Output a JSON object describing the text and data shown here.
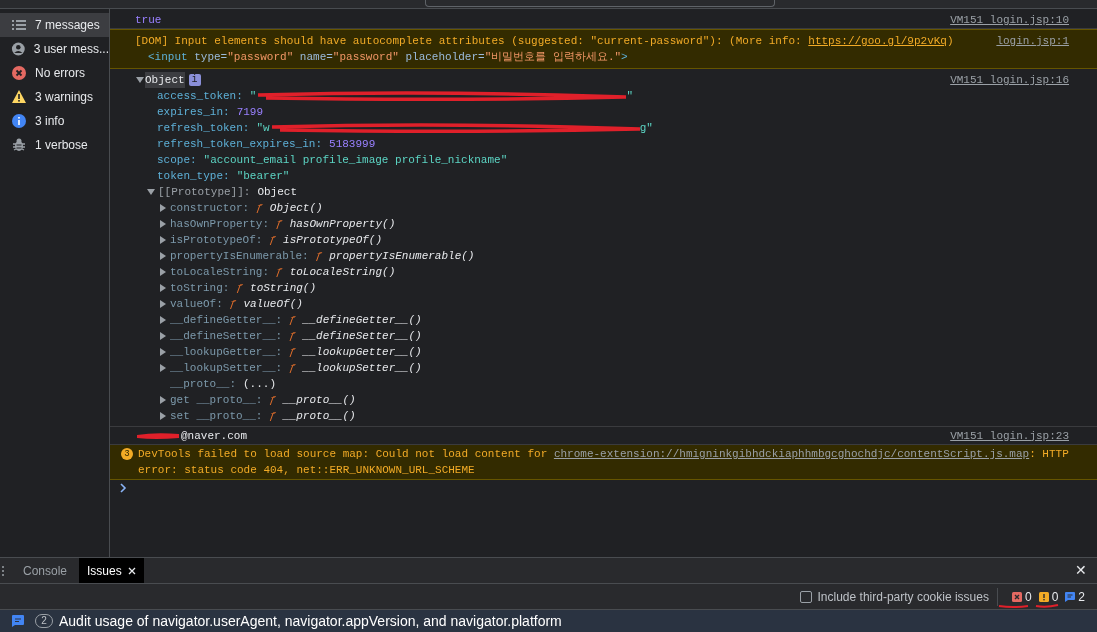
{
  "sidebar": {
    "items": [
      {
        "label": "7 messages",
        "kind": "all",
        "selected": true
      },
      {
        "label": "3 user mess...",
        "kind": "user",
        "selected": false
      },
      {
        "label": "No errors",
        "kind": "error",
        "selected": false
      },
      {
        "label": "3 warnings",
        "kind": "warning",
        "selected": false
      },
      {
        "label": "3 info",
        "kind": "info",
        "selected": false
      },
      {
        "label": "1 verbose",
        "kind": "verbose",
        "selected": false
      }
    ]
  },
  "console": {
    "messages": [
      {
        "kind": "boolean",
        "text": "true",
        "source": "VM151 login.jsp:10"
      },
      {
        "kind": "warning",
        "text": "[DOM] Input elements should have autocomplete attributes (suggested: \"current-password\"): (More info: ",
        "link": "https://goo.gl/9p2vKq",
        "after": ")",
        "source": "login.jsp:1",
        "snippet": [
          {
            "text": "<input",
            "kind": "tag"
          },
          {
            "text": " type=",
            "kind": "attr"
          },
          {
            "text": "\"password\"",
            "kind": "value"
          },
          {
            "text": " name=",
            "kind": "attr"
          },
          {
            "text": "\"password\"",
            "kind": "value"
          },
          {
            "text": " placeholder=",
            "kind": "attr"
          },
          {
            "text": "\"비밀번호를 입력하세요.\"",
            "kind": "value"
          },
          {
            "text": ">",
            "kind": "tag"
          }
        ]
      },
      {
        "kind": "object",
        "label": "Object",
        "info": "i",
        "expanded": true,
        "source": "VM151 login.jsp:16",
        "properties": [
          {
            "key": "access_token:",
            "kind": "redacted",
            "open": "\"",
            "close": "\""
          },
          {
            "key": "expires_in:",
            "kind": "number",
            "value": "7199"
          },
          {
            "key": "refresh_token:",
            "kind": "redacted",
            "open": "\"w",
            "close": "g\""
          },
          {
            "key": "refresh_token_expires_in:",
            "kind": "number",
            "value": "5183999"
          },
          {
            "key": "scope:",
            "kind": "string",
            "value": "\"account_email profile_image profile_nickname\""
          },
          {
            "key": "token_type:",
            "kind": "string",
            "value": "\"bearer\""
          }
        ],
        "prototype": {
          "key": "[[Prototype]]:",
          "value": "Object",
          "expanded": true,
          "children": [
            {
              "key": "constructor:",
              "expandable": true,
              "f": "ƒ",
              "value": "Object()"
            },
            {
              "key": "hasOwnProperty:",
              "expandable": true,
              "f": "ƒ",
              "value": "hasOwnProperty()"
            },
            {
              "key": "isPrototypeOf:",
              "expandable": true,
              "f": "ƒ",
              "value": "isPrototypeOf()"
            },
            {
              "key": "propertyIsEnumerable:",
              "expandable": true,
              "f": "ƒ",
              "value": "propertyIsEnumerable()"
            },
            {
              "key": "toLocaleString:",
              "expandable": true,
              "f": "ƒ",
              "value": "toLocaleString()"
            },
            {
              "key": "toString:",
              "expandable": true,
              "f": "ƒ",
              "value": "toString()"
            },
            {
              "key": "valueOf:",
              "expandable": true,
              "f": "ƒ",
              "value": "valueOf()"
            },
            {
              "key": "__defineGetter__:",
              "expandable": true,
              "f": "ƒ",
              "value": "__defineGetter__()"
            },
            {
              "key": "__defineSetter__:",
              "expandable": true,
              "f": "ƒ",
              "value": "__defineSetter__()"
            },
            {
              "key": "__lookupGetter__:",
              "expandable": true,
              "f": "ƒ",
              "value": "__lookupGetter__()"
            },
            {
              "key": "__lookupSetter__:",
              "expandable": true,
              "f": "ƒ",
              "value": "__lookupSetter__()"
            },
            {
              "key": "__proto__:",
              "expandable": false,
              "value": "(...)"
            },
            {
              "key": "get __proto__:",
              "expandable": true,
              "f": "ƒ",
              "value": "__proto__()"
            },
            {
              "key": "set __proto__:",
              "expandable": true,
              "f": "ƒ",
              "value": "__proto__()"
            }
          ]
        }
      },
      {
        "kind": "email",
        "text": "@naver.com",
        "source": "VM151 login.jsp:23"
      },
      {
        "kind": "sourcemap",
        "count": "3",
        "text": "DevTools failed to load source map: Could not load content for ",
        "link": "chrome-extension://hmigninkgibhdckiaphhmbgcghochdjc/contentScript.js.map",
        "after": ": HTTP error: status code 404, net::ERR_UNKNOWN_URL_SCHEME"
      }
    ]
  },
  "drawer": {
    "tabs": [
      {
        "label": "Console",
        "selected": false,
        "closable": false
      },
      {
        "label": "Issues",
        "selected": true,
        "closable": true
      }
    ],
    "close": "✕",
    "toolbar": {
      "checkbox": {
        "label": "Include third-party cookie issues",
        "checked": false
      },
      "counts": [
        {
          "kind": "error",
          "value": "0"
        },
        {
          "kind": "warning",
          "value": "0"
        },
        {
          "kind": "info",
          "value": "2"
        }
      ]
    },
    "issues": [
      {
        "count": "2",
        "text": "Audit usage of navigator.userAgent, navigator.appVersion, and navigator.platform"
      }
    ]
  }
}
